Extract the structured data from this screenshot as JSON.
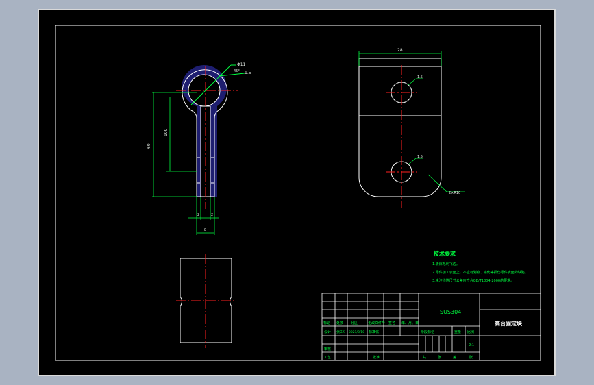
{
  "drawing": {
    "background": "#000000",
    "frame_color": "#ffffff",
    "centerline_color": "#ff2020",
    "dimension_color": "#00ff40",
    "leader_color": "#00ff40",
    "section_color": "#1a1a66"
  },
  "dimensions": {
    "top_width": "28",
    "hole_top": "1.5",
    "hole_bottom": "1.5",
    "corner_radius": "2×R10",
    "ring_dia": "Φ11",
    "ring_wall": "1.5",
    "ring_angle": "45°",
    "overall_len": "60",
    "inner_len": "100",
    "stem_w1": "2",
    "stem_w2": "2",
    "stem_total": "8"
  },
  "tech_requirements": {
    "title": "技术要求",
    "lines": [
      "1.去除毛刺飞边。",
      "2.零件加工表面上，不应有划痕、擦伤等损伤零件表面的缺陷。",
      "3.未注线性尺寸公差应符合GB/T1804-2000的要求。"
    ]
  },
  "title_block": {
    "material": "SUS304",
    "part_name": "高台固定块",
    "row_labels": [
      "标记",
      "处数",
      "分区",
      "更改文件号",
      "签名",
      "年、月、日"
    ],
    "design": "设计",
    "designer": "张XX",
    "std": "标准化",
    "review": "审核",
    "process": "工艺",
    "approve": "批准",
    "date": "2021/8/10",
    "stage": "阶段标记",
    "weight": "重量",
    "scale_label": "比例",
    "scale": "2:1",
    "sheets": "共",
    "sheet_of": "张",
    "sheet_no": "第",
    "sheet_end": "张"
  }
}
